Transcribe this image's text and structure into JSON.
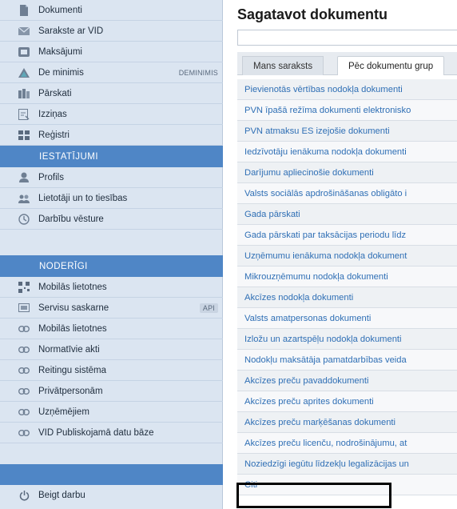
{
  "sidebar": {
    "items": [
      {
        "label": "Dokumenti",
        "icon": "document-icon"
      },
      {
        "label": "Sarakste ar VID",
        "icon": "mail-icon"
      },
      {
        "label": "Maksājumi",
        "icon": "payment-icon"
      },
      {
        "label": "De minimis",
        "icon": "warning-triangle-icon",
        "tag": "DEMINIMIS"
      },
      {
        "label": "Pārskati",
        "icon": "reports-icon"
      },
      {
        "label": "Izziņas",
        "icon": "certificate-icon"
      },
      {
        "label": "Reģistri",
        "icon": "grid-icon"
      }
    ],
    "section_settings": "IESTATĪJUMI",
    "settings_items": [
      {
        "label": "Profils",
        "icon": "user-icon"
      },
      {
        "label": "Lietotāji un to tiesības",
        "icon": "users-icon"
      },
      {
        "label": "Darbību vēsture",
        "icon": "history-icon"
      }
    ],
    "section_useful": "NODERĪGI",
    "useful_items": [
      {
        "label": "Mobilās lietotnes",
        "icon": "qr-code-icon"
      },
      {
        "label": "Servisu saskarne",
        "icon": "api-icon",
        "tag": "API"
      },
      {
        "label": "Mobilās lietotnes",
        "icon": "link-icon"
      },
      {
        "label": "Normatīvie akti",
        "icon": "link-icon"
      },
      {
        "label": "Reitingu sistēma",
        "icon": "link-icon"
      },
      {
        "label": "Privātpersonām",
        "icon": "link-icon"
      },
      {
        "label": "Uzņēmējiem",
        "icon": "link-icon"
      },
      {
        "label": "VID Publiskojamā datu bāze",
        "icon": "link-icon"
      }
    ],
    "logout": {
      "label": "Beigt darbu",
      "icon": "power-icon"
    }
  },
  "main": {
    "title": "Sagatavot dokumentu",
    "search_value": "",
    "tabs": [
      {
        "label": "Mans saraksts"
      },
      {
        "label": "Pēc dokumentu grup"
      }
    ],
    "documents": [
      "Pievienotās vērtības nodokļa dokumenti",
      "PVN īpašā režīma dokumenti elektronisko",
      "PVN atmaksu ES izejošie dokumenti",
      "Iedzīvotāju ienākuma nodokļa dokumenti",
      "Darījumu apliecinošie dokumenti",
      "Valsts sociālās apdrošināšanas obligāto i",
      "Gada pārskati",
      "Gada pārskati par taksācijas periodu līdz",
      "Uzņēmumu ienākuma nodokļa dokument",
      "Mikrouzņēmumu nodokļa dokumenti",
      "Akcīzes nodokļa dokumenti",
      "Valsts amatpersonas dokumenti",
      "Izložu un azartspēļu nodokļa dokumenti",
      "Nodokļu maksātāja pamatdarbības veida",
      "Akcīzes preču pavaddokumenti",
      "Akcīzes preču aprites dokumenti",
      "Akcīzes preču marķēšanas dokumenti",
      "Akcīzes preču licenču, nodrošinājumu, at",
      "Noziedzīgi iegūtu līdzekļu legalizācijas un",
      "Citi"
    ]
  },
  "colors": {
    "sidebar_bg": "#dbe5f1",
    "section_header": "#4f86c6",
    "link": "#2f6fb5",
    "highlight_border": "#000000"
  }
}
